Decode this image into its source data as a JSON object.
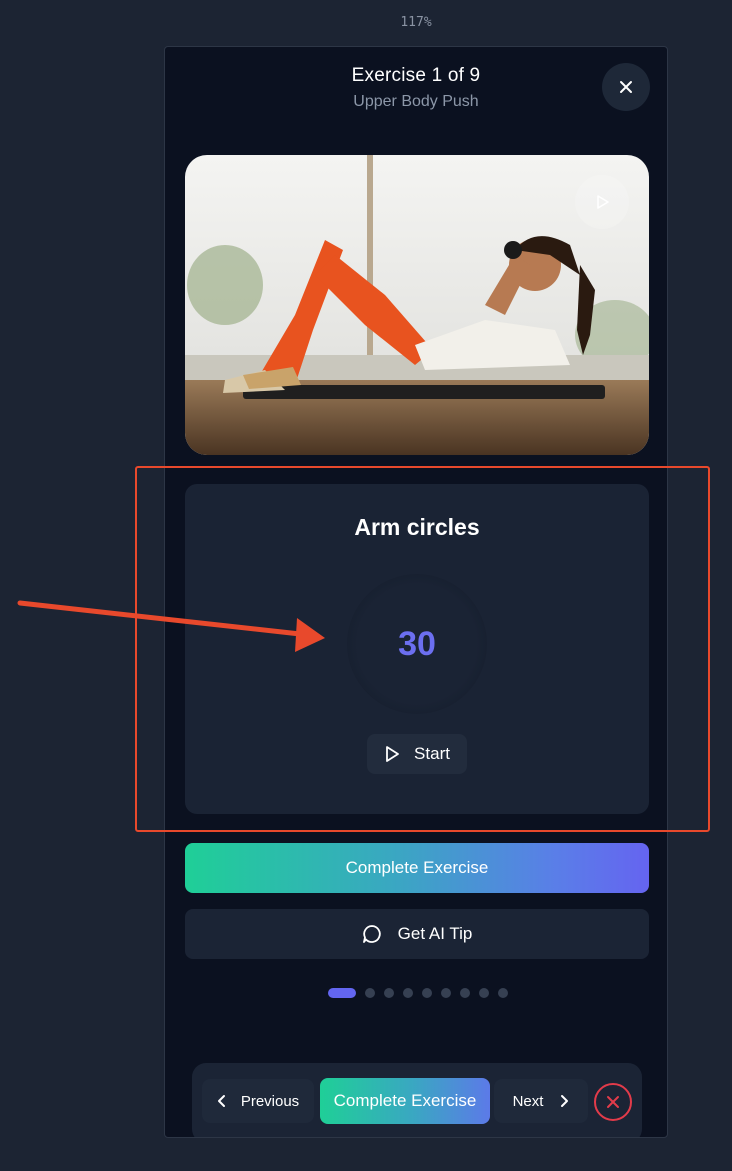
{
  "zoom_level": "117%",
  "header": {
    "title": "Exercise 1 of 9",
    "subtitle": "Upper Body Push"
  },
  "icons": {
    "close": "close-icon",
    "play": "play-icon",
    "chat": "chat-icon",
    "chevron_left": "chevron-left-icon",
    "chevron_right": "chevron-right-icon"
  },
  "media": {
    "kind": "exercise-photo"
  },
  "timer": {
    "exercise_name": "Arm circles",
    "seconds": "30",
    "start_label": "Start"
  },
  "actions": {
    "complete_label": "Complete Exercise",
    "tip_label": "Get AI Tip"
  },
  "progress": {
    "total": 9,
    "current": 1
  },
  "bottom_bar": {
    "previous_label": "Previous",
    "complete_label": "Complete Exercise",
    "next_label": "Next"
  },
  "colors": {
    "accent": "#6366f1",
    "gradient_start": "#1fcf97",
    "gradient_end": "#6564f0",
    "annotation": "#e8492c",
    "danger": "#e23b4a"
  }
}
